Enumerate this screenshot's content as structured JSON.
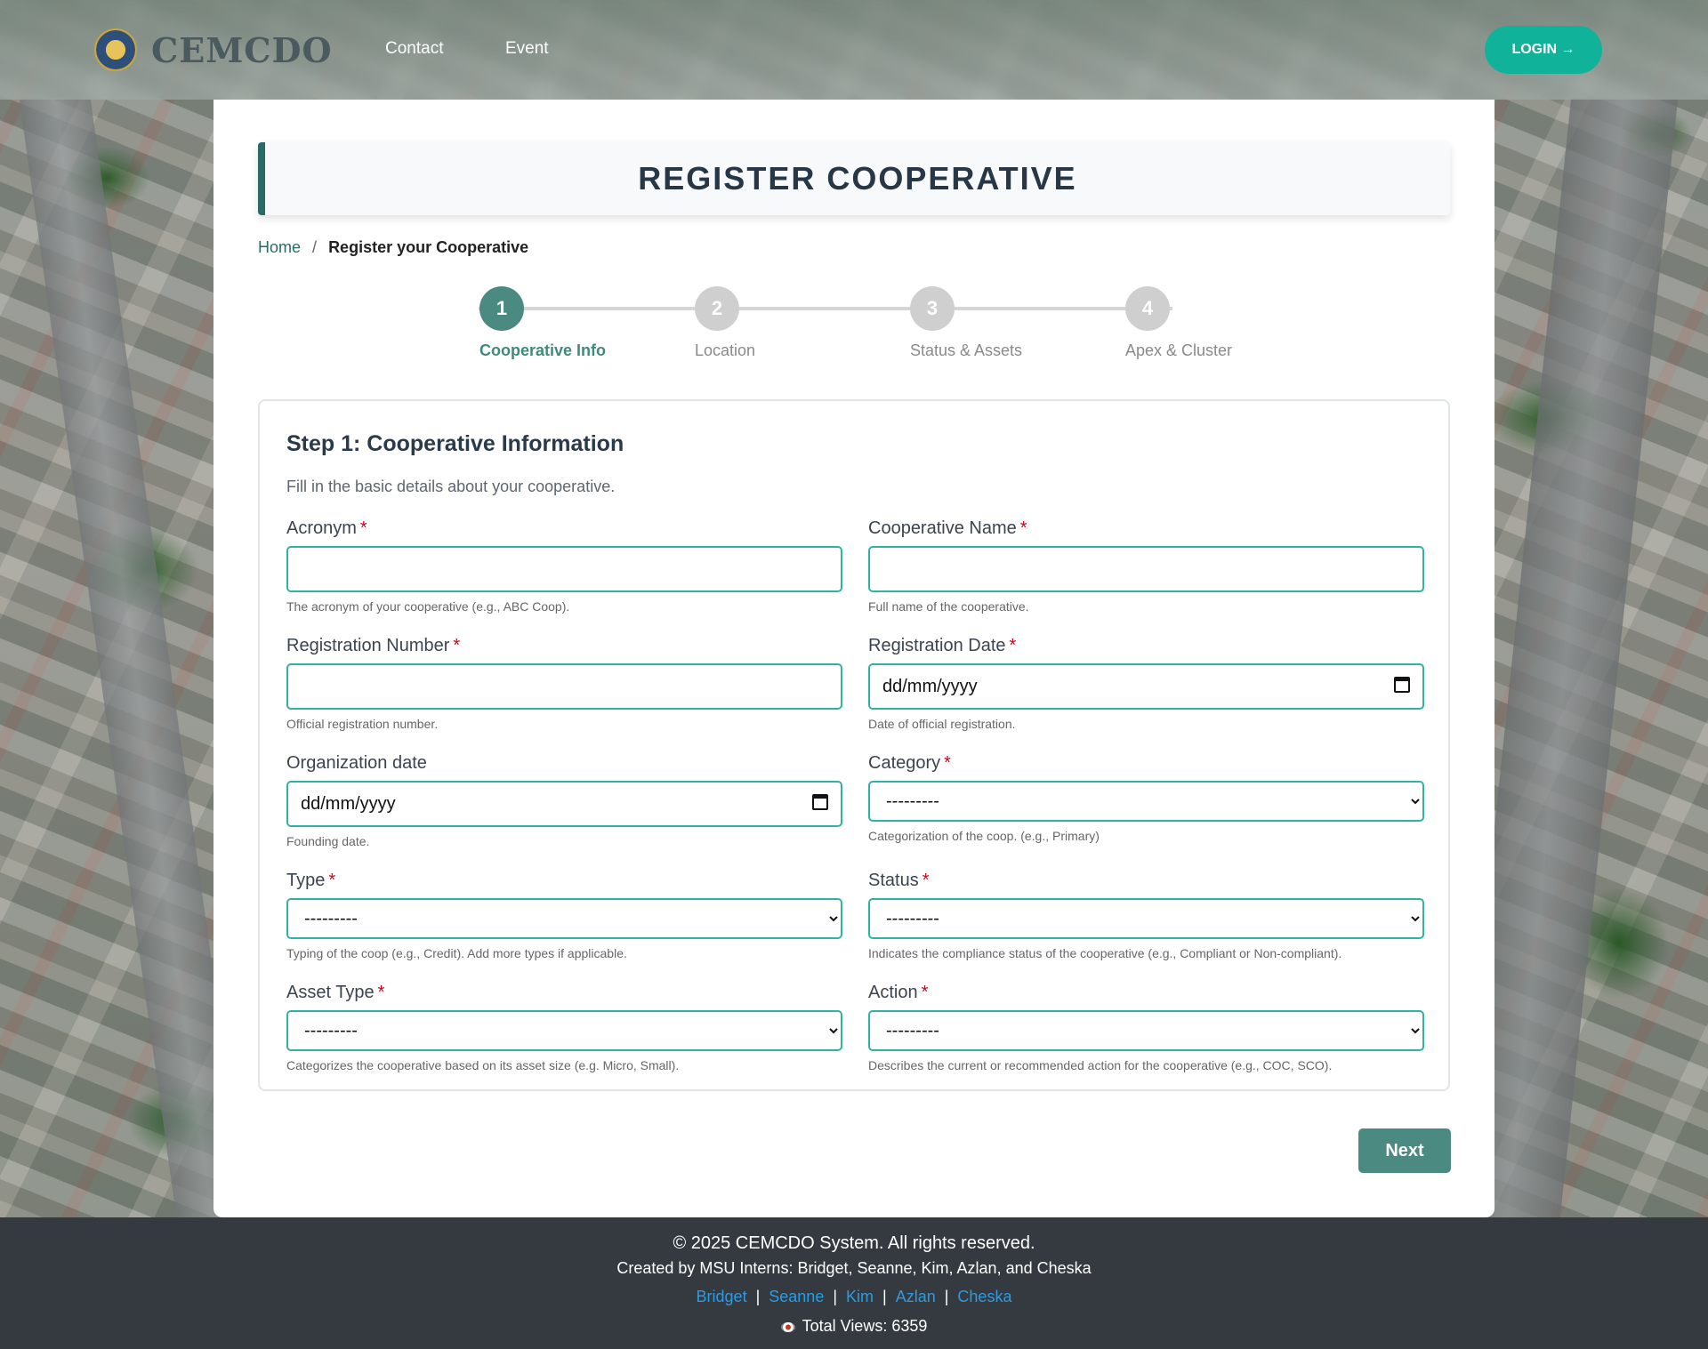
{
  "header": {
    "brand": "CEMCDO",
    "nav": [
      "Contact",
      "Event"
    ],
    "login_label": "LOGIN →"
  },
  "page": {
    "title": "REGISTER COOPERATIVE",
    "breadcrumb": {
      "home": "Home",
      "separator": "/",
      "current": "Register your Cooperative"
    }
  },
  "stepper": {
    "steps": [
      {
        "number": "1",
        "label": "Cooperative Info",
        "active": true
      },
      {
        "number": "2",
        "label": "Location",
        "active": false
      },
      {
        "number": "3",
        "label": "Status & Assets",
        "active": false
      },
      {
        "number": "4",
        "label": "Apex & Cluster",
        "active": false
      }
    ]
  },
  "form": {
    "title": "Step 1: Cooperative Information",
    "subtitle": "Fill in the basic details about your cooperative.",
    "required_mark": "*",
    "fields": {
      "acronym": {
        "label": "Acronym",
        "value": "",
        "help": "The acronym of your cooperative (e.g., ABC Coop)."
      },
      "coop_name": {
        "label": "Cooperative Name",
        "value": "",
        "help": "Full name of the cooperative."
      },
      "reg_number": {
        "label": "Registration Number",
        "value": "",
        "help": "Official registration number."
      },
      "reg_date": {
        "label": "Registration Date",
        "placeholder": "dd/mm/yyyy",
        "help": "Date of official registration."
      },
      "org_date": {
        "label": "Organization date",
        "placeholder": "dd/mm/yyyy",
        "help": "Founding date."
      },
      "category": {
        "label": "Category",
        "selected": "---------",
        "help": "Categorization of the coop. (e.g., Primary)"
      },
      "type": {
        "label": "Type",
        "selected": "---------",
        "help": "Typing of the coop (e.g., Credit). Add more types if applicable."
      },
      "status": {
        "label": "Status",
        "selected": "---------",
        "help": "Indicates the compliance status of the cooperative (e.g., Compliant or Non-compliant)."
      },
      "asset_type": {
        "label": "Asset Type",
        "selected": "---------",
        "help": "Categorizes the cooperative based on its asset size (e.g. Micro, Small)."
      },
      "action": {
        "label": "Action",
        "selected": "---------",
        "help": "Describes the current or recommended action for the cooperative (e.g., COC, SCO)."
      }
    },
    "next_label": "Next"
  },
  "footer": {
    "copyright": "© 2025 CEMCDO System. All rights reserved.",
    "credits": "Created by MSU Interns: Bridget, Seanne, Kim, Azlan, and Cheska",
    "links": [
      "Bridget",
      "Seanne",
      "Kim",
      "Azlan",
      "Cheska"
    ],
    "separator": "|",
    "views": "Total Views: 6359"
  },
  "colors": {
    "accent": "#4a8a80",
    "login": "#10b39a",
    "input_border": "#2fb3a3",
    "footer_bg": "#343a40",
    "link": "#2f9bde",
    "required": "#d0021b"
  }
}
